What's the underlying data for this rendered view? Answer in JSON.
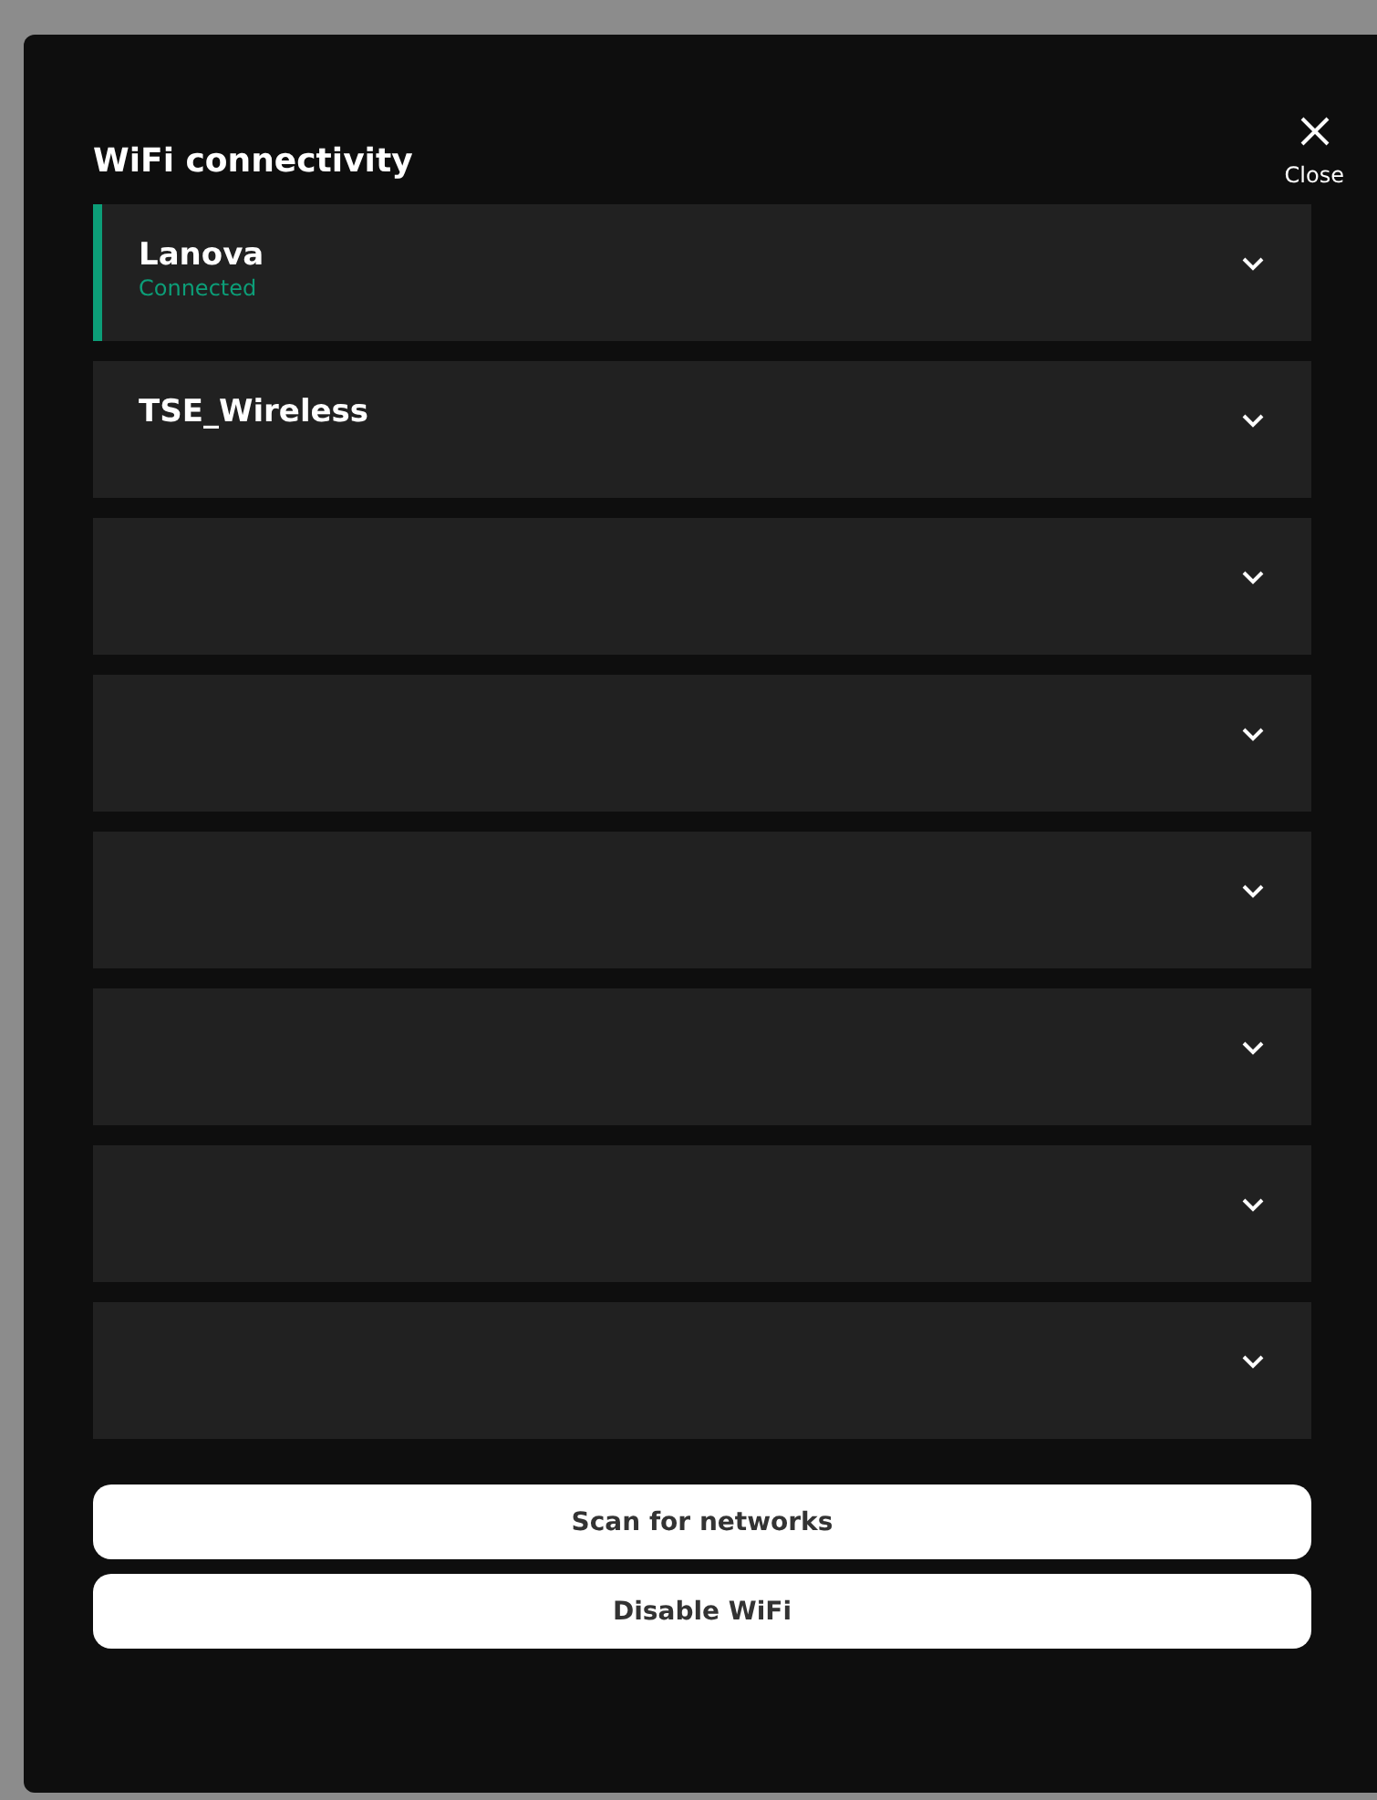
{
  "dialog": {
    "title": "WiFi connectivity",
    "close_label": "Close"
  },
  "networks": [
    {
      "name": "Lanova",
      "status": "Connected",
      "connected": true,
      "expanded": false
    },
    {
      "name": "TSE_Wireless",
      "connected": false,
      "expanded": false
    },
    {
      "connected": false,
      "expanded": false
    },
    {
      "connected": false,
      "expanded": false
    },
    {
      "connected": false,
      "expanded": false
    },
    {
      "connected": false,
      "expanded": false
    },
    {
      "connected": false,
      "expanded": false
    },
    {
      "connected": false,
      "expanded": false
    }
  ],
  "buttons": [
    "Scan for networks",
    "Disable WiFi"
  ]
}
